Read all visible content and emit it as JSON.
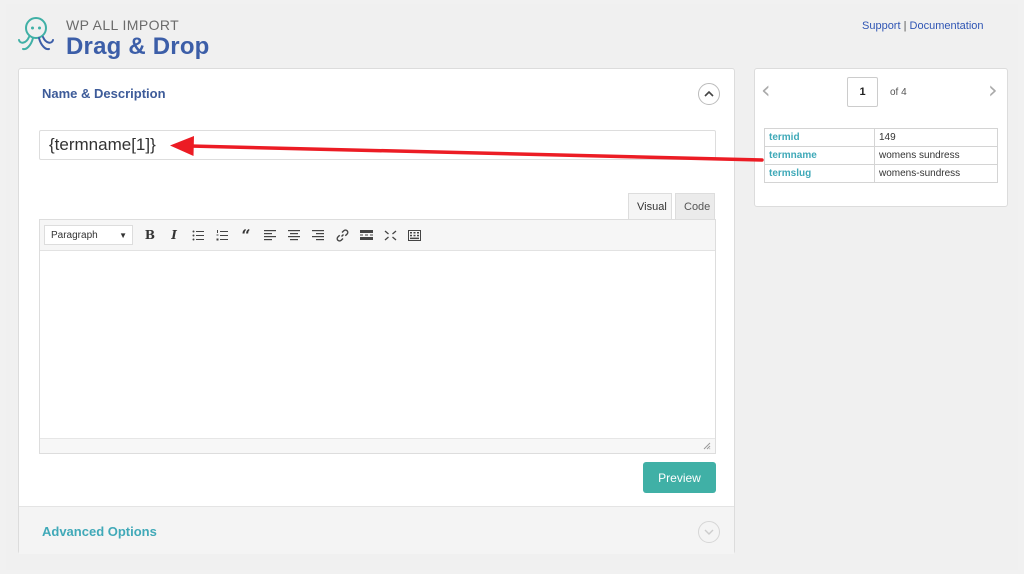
{
  "header": {
    "brand_small": "WP ALL IMPORT",
    "brand_big": "Drag & Drop",
    "support_label": "Support",
    "separator": " | ",
    "documentation_label": "Documentation"
  },
  "name_description": {
    "title": "Name & Description",
    "name_value": "{termname[1]}",
    "tab_visual": "Visual",
    "tab_code": "Code",
    "format_select": "Paragraph",
    "toolbar_icons": [
      "bold-icon",
      "italic-icon",
      "bullet-list-icon",
      "numbered-list-icon",
      "blockquote-icon",
      "align-left-icon",
      "align-center-icon",
      "align-right-icon",
      "link-icon",
      "read-more-icon",
      "fullscreen-icon",
      "toolbar-toggle-icon"
    ],
    "preview_label": "Preview"
  },
  "advanced": {
    "title": "Advanced Options"
  },
  "record_viewer": {
    "page": "1",
    "of_label": "of 4",
    "rows": [
      {
        "key": "termid",
        "value": "149"
      },
      {
        "key": "termname",
        "value": "womens sundress"
      },
      {
        "key": "termslug",
        "value": "womens-sundress"
      }
    ]
  },
  "colors": {
    "brand_blue": "#3c5ea8",
    "teal": "#40b0a6",
    "arrow_red": "#ec1c24"
  }
}
